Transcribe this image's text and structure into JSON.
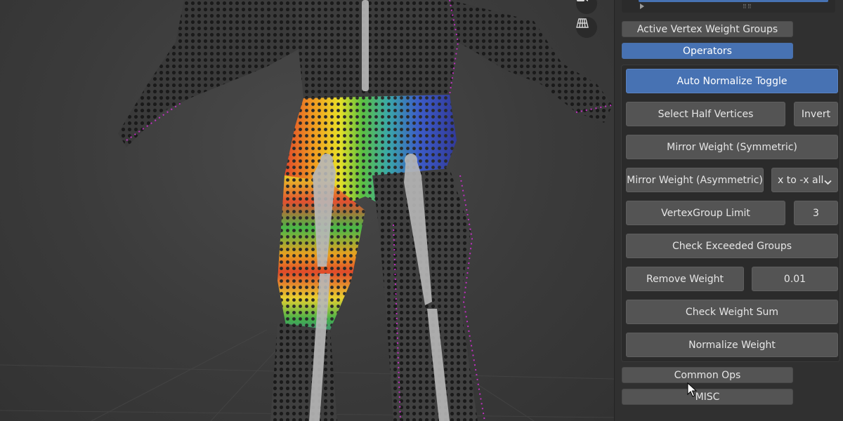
{
  "viewport": {
    "icons": [
      "camera-icon",
      "perspective-grid-icon"
    ]
  },
  "sidebar": {
    "section_buttons": {
      "active_vertex_weight_groups": "Active Vertex Weight Groups",
      "operators": "Operators",
      "common_ops": "Common Ops",
      "misc": "MISC"
    },
    "operators": {
      "auto_normalize_toggle": "Auto Normalize Toggle",
      "select_half_vertices": "Select Half Vertices",
      "invert": "Invert",
      "mirror_weight_symmetric": "Mirror Weight (Symmetric)",
      "mirror_weight_asymmetric": "Mirror Weight (Asymmetric)",
      "mirror_direction_value": "x to -x all",
      "vertexgroup_limit": "VertexGroup Limit",
      "vertexgroup_limit_value": "3",
      "check_exceeded_groups": "Check Exceeded Groups",
      "remove_weight": "Remove Weight",
      "remove_weight_value": "0.01",
      "check_weight_sum": "Check Weight Sum",
      "normalize_weight": "Normalize Weight"
    }
  },
  "colors": {
    "accent_blue": "#4772b3",
    "button_gray": "#545454",
    "panel_bg": "#303030",
    "viewport_bg": "#3d3d3d"
  }
}
